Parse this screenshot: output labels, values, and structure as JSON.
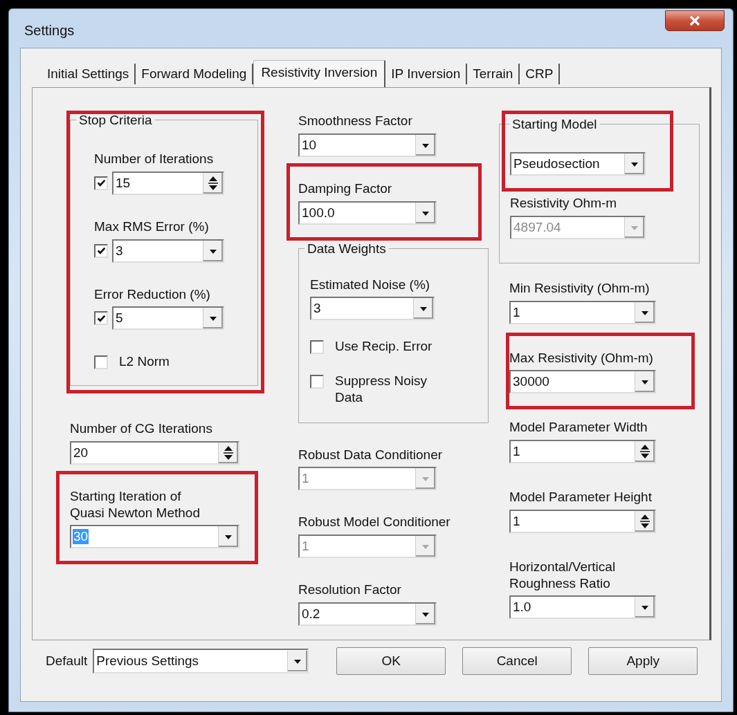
{
  "window": {
    "title": "Settings"
  },
  "tabs": [
    {
      "label": "Initial Settings",
      "selected": false
    },
    {
      "label": "Forward Modeling",
      "selected": false
    },
    {
      "label": "Resistivity Inversion",
      "selected": true
    },
    {
      "label": "IP Inversion",
      "selected": false
    },
    {
      "label": "Terrain",
      "selected": false
    },
    {
      "label": "CRP",
      "selected": false
    }
  ],
  "columns": [
    {
      "items": [
        {
          "kind": "group",
          "legend": "Stop Criteria",
          "highlighted": true,
          "items": [
            {
              "kind": "spin",
              "label": "Number of Iterations",
              "checked": true,
              "value": "15",
              "disabled": false,
              "value_selected": false
            },
            {
              "kind": "combo",
              "label": "Max RMS Error (%)",
              "checked": true,
              "value": "3",
              "disabled": false,
              "value_selected": false
            },
            {
              "kind": "combo",
              "label": "Error Reduction (%)",
              "checked": true,
              "value": "5",
              "disabled": false,
              "value_selected": false
            },
            {
              "kind": "checkbox",
              "label": "L2 Norm",
              "checked": false
            }
          ]
        },
        {
          "kind": "spin",
          "label": "Number of CG Iterations",
          "value": "20",
          "disabled": false,
          "value_selected": false,
          "highlighted": false
        },
        {
          "kind": "combo",
          "label": "Starting Iteration of\nQuasi Newton Method",
          "value": "30",
          "disabled": false,
          "value_selected": true,
          "highlighted": true
        }
      ]
    },
    {
      "items": [
        {
          "kind": "combo",
          "label": "Smoothness Factor",
          "value": "10",
          "disabled": false,
          "value_selected": false,
          "highlighted": false
        },
        {
          "kind": "combo",
          "label": "Damping Factor",
          "value": "100.0",
          "disabled": false,
          "value_selected": false,
          "highlighted": true
        },
        {
          "kind": "group",
          "legend": "Data Weights",
          "highlighted": false,
          "items": [
            {
              "kind": "combo",
              "label": "Estimated Noise (%)",
              "value": "3",
              "disabled": false,
              "value_selected": false
            },
            {
              "kind": "checkbox",
              "label": "Use Recip. Error",
              "checked": false
            },
            {
              "kind": "checkbox",
              "label": "Suppress Noisy\nData",
              "checked": false
            }
          ]
        },
        {
          "kind": "combo",
          "label": "Robust Data Conditioner",
          "value": "1",
          "disabled": true,
          "value_selected": false,
          "highlighted": false
        },
        {
          "kind": "combo",
          "label": "Robust Model Conditioner",
          "value": "1",
          "disabled": true,
          "value_selected": false,
          "highlighted": false
        },
        {
          "kind": "combo",
          "label": "Resolution Factor",
          "value": "0.2",
          "disabled": false,
          "value_selected": false,
          "highlighted": false
        }
      ]
    },
    {
      "items": [
        {
          "kind": "group",
          "legend": "Starting Model",
          "highlighted": false,
          "items": [
            {
              "kind": "combo",
              "value": "Pseudosection",
              "disabled": false,
              "value_selected": false,
              "highlighted": true
            },
            {
              "kind": "combo",
              "label": "Resistivity Ohm-m",
              "value": "4897.04",
              "disabled": true,
              "value_selected": false,
              "highlighted": false
            }
          ]
        },
        {
          "kind": "combo",
          "label": "Min Resistivity (Ohm-m)",
          "value": "1",
          "disabled": false,
          "value_selected": false,
          "highlighted": false
        },
        {
          "kind": "combo",
          "label": "Max Resistivity (Ohm-m)",
          "value": "30000",
          "disabled": false,
          "value_selected": false,
          "highlighted": true
        },
        {
          "kind": "spin",
          "label": "Model Parameter Width",
          "value": "1",
          "disabled": false,
          "value_selected": false,
          "highlighted": false
        },
        {
          "kind": "spin",
          "label": "Model Parameter Height",
          "value": "1",
          "disabled": false,
          "value_selected": false,
          "highlighted": false
        },
        {
          "kind": "combo",
          "label": "Horizontal/Vertical\nRoughness Ratio",
          "value": "1.0",
          "disabled": false,
          "value_selected": false,
          "highlighted": false
        }
      ]
    }
  ],
  "footer": {
    "default_label": "Default",
    "default_value": "Previous Settings",
    "buttons": [
      "OK",
      "Cancel",
      "Apply"
    ]
  }
}
